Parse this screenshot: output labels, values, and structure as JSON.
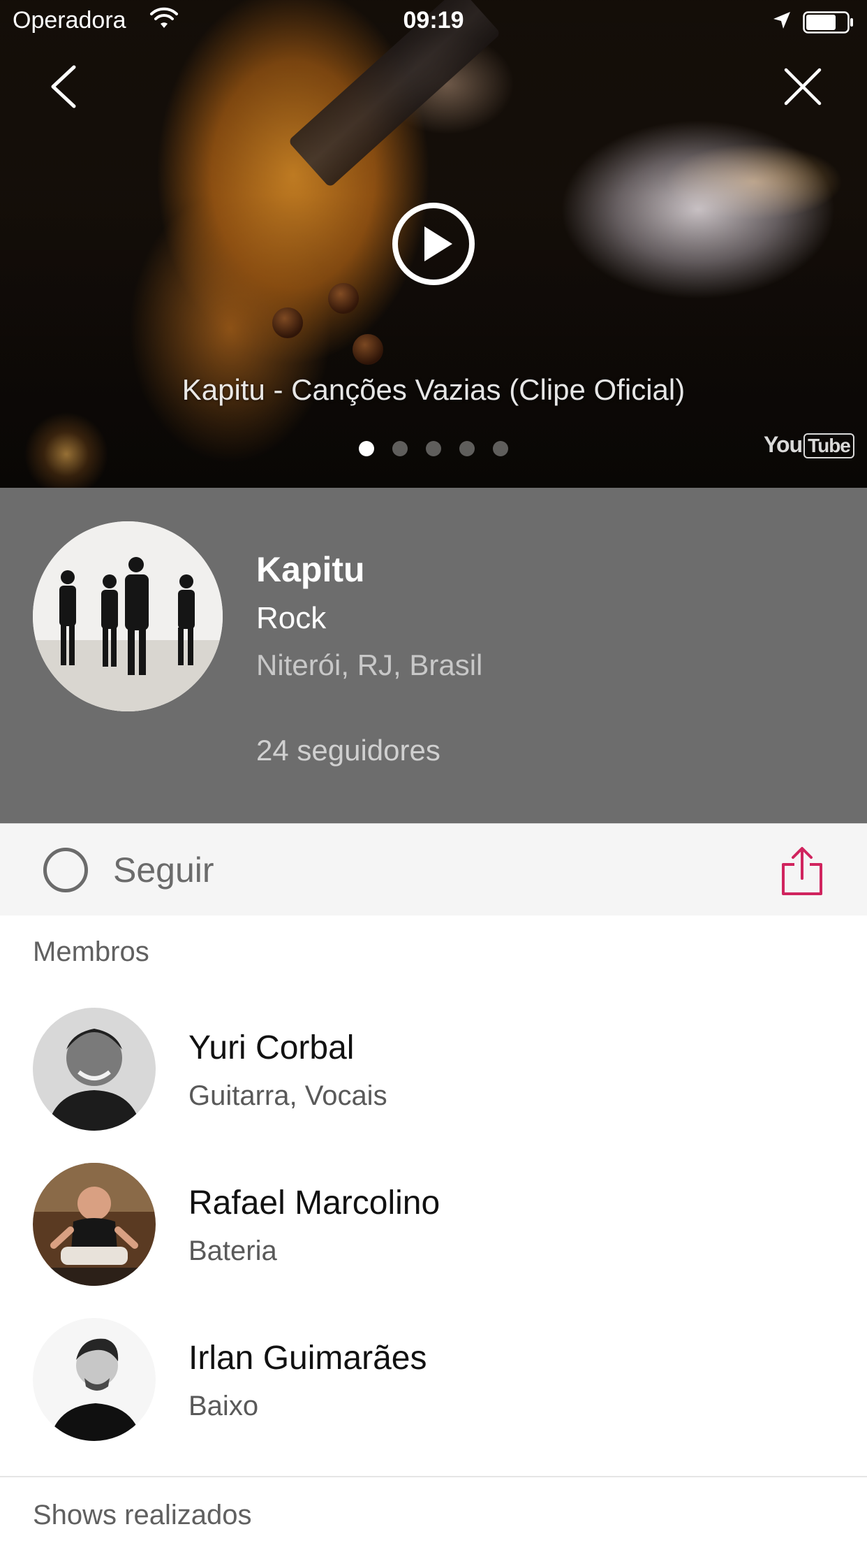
{
  "status_bar": {
    "carrier": "Operadora",
    "time": "09:19"
  },
  "icons": {
    "back": "chevron-left-icon",
    "close": "close-icon",
    "play": "play-circle-icon",
    "share": "share-icon",
    "wifi": "wifi-icon",
    "location": "location-arrow-icon",
    "battery": "battery-icon"
  },
  "video": {
    "title": "Kapitu - Canções Vazias (Clipe Oficial)",
    "pager": {
      "count": 5,
      "active_index": 0
    },
    "logo_you": "You",
    "logo_tube": "Tube"
  },
  "band": {
    "name": "Kapitu",
    "genre": "Rock",
    "location": "Niterói, RJ, Brasil",
    "followers": "24 seguidores"
  },
  "actions": {
    "follow_label": "Seguir"
  },
  "members": {
    "heading": "Membros",
    "items": [
      {
        "name": "Yuri Corbal",
        "role": "Guitarra, Vocais"
      },
      {
        "name": "Rafael Marcolino",
        "role": "Bateria"
      },
      {
        "name": "Irlan Guimarães",
        "role": "Baixo"
      }
    ]
  },
  "shows": {
    "heading": "Shows realizados"
  },
  "colors": {
    "band_panel": "#6d6d6d",
    "accent_share": "#d0245e",
    "action_bar": "#f5f5f5"
  }
}
